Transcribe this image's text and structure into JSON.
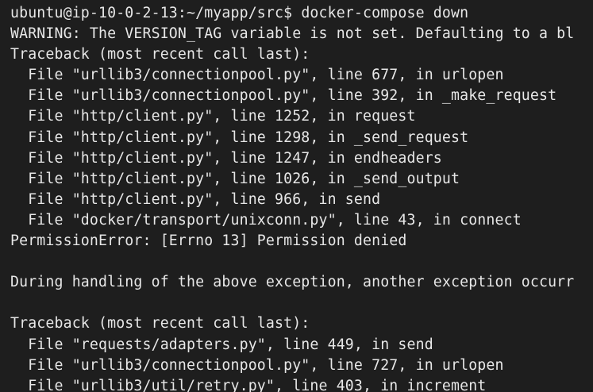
{
  "terminal": {
    "prompt": "ubuntu@ip-10-0-2-13:~/myapp/src$",
    "command": "docker-compose down",
    "output_lines": [
      "WARNING: The VERSION_TAG variable is not set. Defaulting to a bl",
      "Traceback (most recent call last):",
      "  File \"urllib3/connectionpool.py\", line 677, in urlopen",
      "  File \"urllib3/connectionpool.py\", line 392, in _make_request",
      "  File \"http/client.py\", line 1252, in request",
      "  File \"http/client.py\", line 1298, in _send_request",
      "  File \"http/client.py\", line 1247, in endheaders",
      "  File \"http/client.py\", line 1026, in _send_output",
      "  File \"http/client.py\", line 966, in send",
      "  File \"docker/transport/unixconn.py\", line 43, in connect",
      "PermissionError: [Errno 13] Permission denied",
      "",
      "During handling of the above exception, another exception occurr",
      "",
      "Traceback (most recent call last):",
      "  File \"requests/adapters.py\", line 449, in send",
      "  File \"urllib3/connectionpool.py\", line 727, in urlopen",
      "  File \"urllib3/util/retry.py\", line 403, in increment"
    ]
  }
}
